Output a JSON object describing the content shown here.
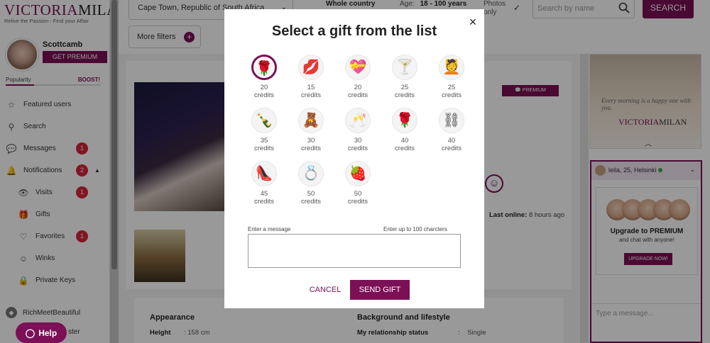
{
  "app": {
    "logo_text_a": "VICTORIA",
    "logo_text_b": "MILAN",
    "logo_tagline": "Relive the Passion - Find your Affair"
  },
  "user": {
    "name": "Scottcamb",
    "get_premium_label": "GET PREMIUM",
    "popularity_label": "Popularity",
    "boost_label": "BOOST!",
    "popularity_level_pct": 30
  },
  "nav": {
    "items": [
      {
        "label": "Featured users",
        "icon": "star-icon"
      },
      {
        "label": "Search",
        "icon": "search-icon"
      },
      {
        "label": "Messages",
        "icon": "chat-icon",
        "badge": "1"
      },
      {
        "label": "Notifications",
        "icon": "bell-icon",
        "badge": "2"
      },
      {
        "label": "Visits",
        "icon": "eye-icon",
        "badge": "1"
      },
      {
        "label": "Gifts",
        "icon": "gift-icon"
      },
      {
        "label": "Favorites",
        "icon": "heart-icon",
        "badge": "1"
      },
      {
        "label": "Winks",
        "icon": "smile-icon"
      },
      {
        "label": "Private Keys",
        "icon": "lock-icon"
      }
    ],
    "rmb_label": "RichMeetBeautiful",
    "help_label": "Help",
    "bottom_partial": "ster"
  },
  "filters": {
    "location": "Cape Town, Republic of South Africa",
    "whole_country": "Whole country",
    "age_label": "Age:",
    "age_range": "18 - 100 years",
    "photos_only": "Photos only",
    "search_placeholder": "Search by name",
    "search_button": "SEARCH",
    "more_filters": "More filters"
  },
  "profile": {
    "premium_tag": "PREMIUM",
    "last_online_label": "Last online:",
    "last_online_value": "8 hours ago",
    "appearance_title": "Appearance",
    "background_title": "Background and lifestyle",
    "height_label": "Height",
    "height_value": ": 158 cm",
    "relationship_label": "My relationship status",
    "relationship_sep": ":",
    "relationship_value": "Single"
  },
  "ad": {
    "slogan": "Every morning is a happy one with you.",
    "logo_a": "VICTORIA",
    "logo_b": "MILAN"
  },
  "chat": {
    "contact": "leila, 25, Helsinki",
    "upgrade_title": "Upgrade to PREMIUM",
    "upgrade_sub": "and chat with anyone!",
    "upgrade_button": "UPGRADE NOW!",
    "input_placeholder": "Type a message..."
  },
  "modal": {
    "title": "Select a gift from the list",
    "close": "×",
    "gifts": [
      {
        "icon": "rose-icon",
        "glyph": "🌹",
        "credits": "20",
        "unit": "credits",
        "selected": true
      },
      {
        "icon": "lips-icon",
        "glyph": "💋",
        "credits": "15",
        "unit": "credits"
      },
      {
        "icon": "heart-box-icon",
        "glyph": "💝",
        "credits": "20",
        "unit": "credits"
      },
      {
        "icon": "cocktail-icon",
        "glyph": "🍸",
        "credits": "25",
        "unit": "credits"
      },
      {
        "icon": "massage-icon",
        "glyph": "💆",
        "credits": "25",
        "unit": "credits"
      },
      {
        "icon": "champagne-bubbles-icon",
        "glyph": "🍾",
        "credits": "35",
        "unit": "credits"
      },
      {
        "icon": "teddy-bear-icon",
        "glyph": "🧸",
        "credits": "30",
        "unit": "credits"
      },
      {
        "icon": "champagne-glasses-icon",
        "glyph": "🥂",
        "credits": "30",
        "unit": "credits"
      },
      {
        "icon": "roses-bouquet-icon",
        "glyph": "🌹",
        "credits": "40",
        "unit": "credits"
      },
      {
        "icon": "handcuffs-icon",
        "glyph": "⛓",
        "credits": "40",
        "unit": "credits"
      },
      {
        "icon": "high-heels-icon",
        "glyph": "👠",
        "credits": "45",
        "unit": "credits"
      },
      {
        "icon": "ring-icon",
        "glyph": "💍",
        "credits": "50",
        "unit": "credits"
      },
      {
        "icon": "strawberry-icon",
        "glyph": "🍓",
        "credits": "50",
        "unit": "credits"
      }
    ],
    "message_label": "Enter a message",
    "message_limit": "Enter up to 100 charcters",
    "message_value": "",
    "cancel_label": "CANCEL",
    "send_label": "SEND GIFT"
  },
  "colors": {
    "brand": "#7b1056",
    "badge": "#d9243b"
  }
}
